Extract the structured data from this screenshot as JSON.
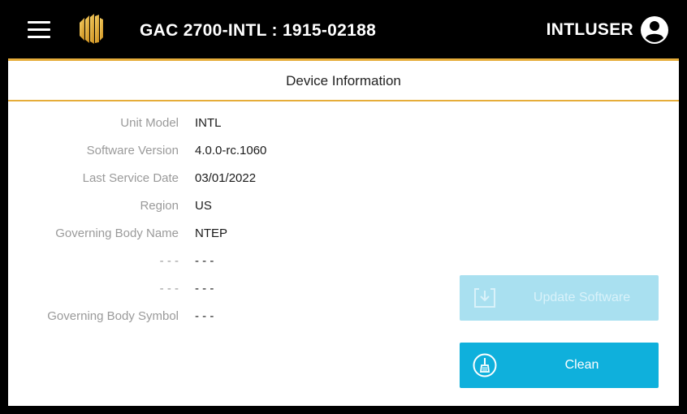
{
  "header": {
    "device_title": "GAC 2700-INTL : 1915-02188",
    "username": "INTLUSER",
    "menu_icon": "hamburger-menu-icon",
    "logo_icon": "brand-logo-icon",
    "user_icon": "user-account-icon",
    "accent_color": "#e6ad3a"
  },
  "section": {
    "title": "Device Information"
  },
  "info": [
    {
      "label": "Unit Model",
      "value": "INTL"
    },
    {
      "label": "Software Version",
      "value": "4.0.0-rc.1060"
    },
    {
      "label": "Last Service Date",
      "value": "03/01/2022"
    },
    {
      "label": "Region",
      "value": "US"
    },
    {
      "label": "Governing Body Name",
      "value": "NTEP"
    },
    {
      "label": "- - -",
      "value": "- - -"
    },
    {
      "label": "- - -",
      "value": "- - -"
    },
    {
      "label": "Governing Body Symbol",
      "value": "- - -"
    }
  ],
  "actions": {
    "update_software": {
      "label": "Update Software",
      "state": "disabled",
      "icon": "download-icon"
    },
    "clean": {
      "label": "Clean",
      "state": "enabled",
      "icon": "broom-icon"
    },
    "button_color": "#0fb0dc"
  }
}
